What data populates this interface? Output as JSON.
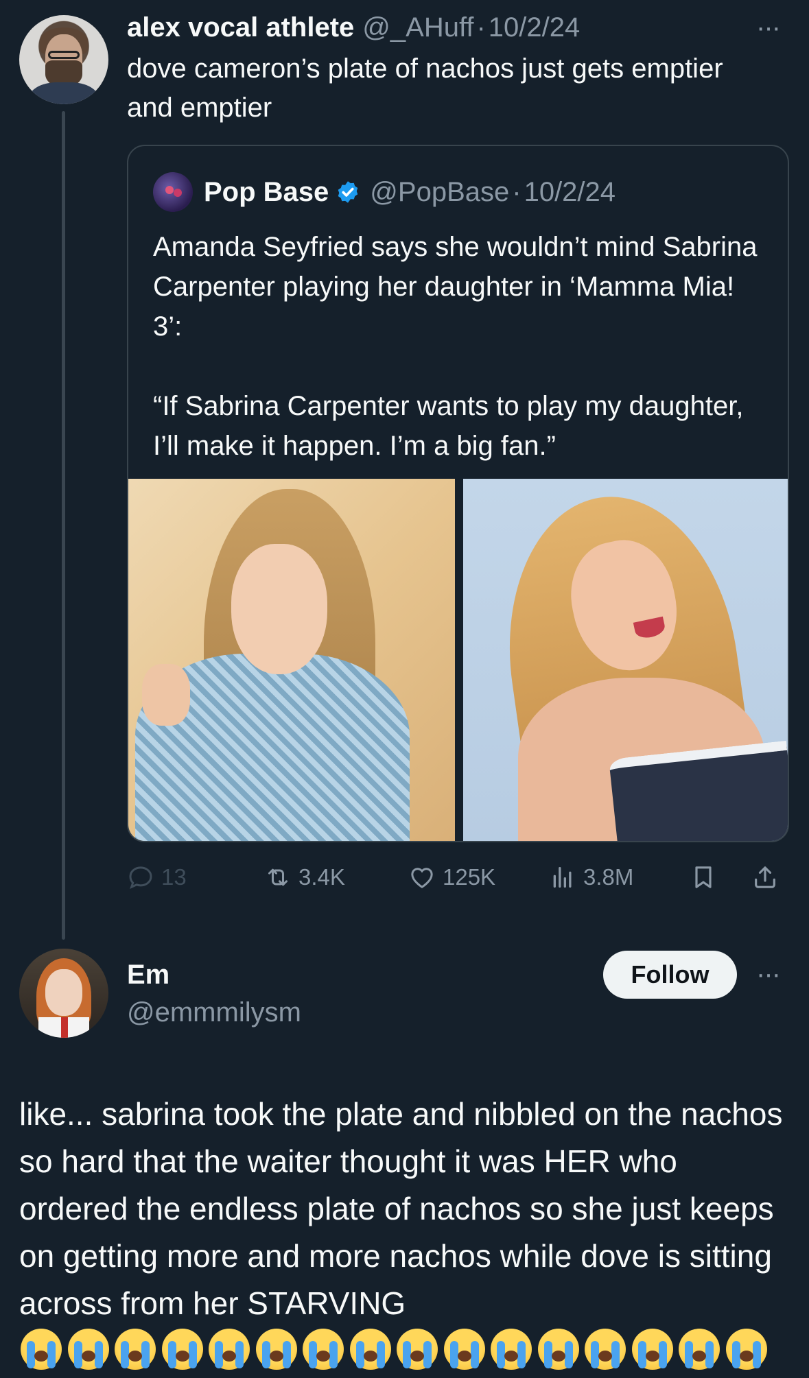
{
  "tweet": {
    "display_name": "alex vocal athlete",
    "handle": "@_AHuff",
    "separator": "·",
    "date": "10/2/24",
    "text": "dove cameron’s plate of nachos just gets emptier and emptier",
    "more": "···"
  },
  "quote": {
    "display_name": "Pop Base",
    "handle": "@PopBase",
    "separator": "·",
    "date": "10/2/24",
    "verified": true,
    "text": "Amanda Seyfried says she wouldn’t mind Sabrina Carpenter playing her daughter in ‘Mamma Mia! 3’:\n\n“If Sabrina Carpenter wants to play my daughter, I’ll make it happen. I’m a big fan.”"
  },
  "actions": {
    "replies": "13",
    "retweets": "3.4K",
    "likes": "125K",
    "views": "3.8M"
  },
  "reply": {
    "display_name": "Em",
    "handle": "@emmmilysm",
    "follow_label": "Follow",
    "more": "···",
    "text": "like... sabrina took the plate and nibbled on the nachos so hard that the waiter thought it was HER who ordered the endless plate of nachos so she just keeps on getting more and more nachos while dove is sitting across from her STARVING",
    "emoji_count": 16
  },
  "colors": {
    "background": "#15202b",
    "text": "#f7f9f9",
    "secondary": "#8b98a5",
    "border": "#38444d",
    "verified": "#1d9bf0"
  }
}
